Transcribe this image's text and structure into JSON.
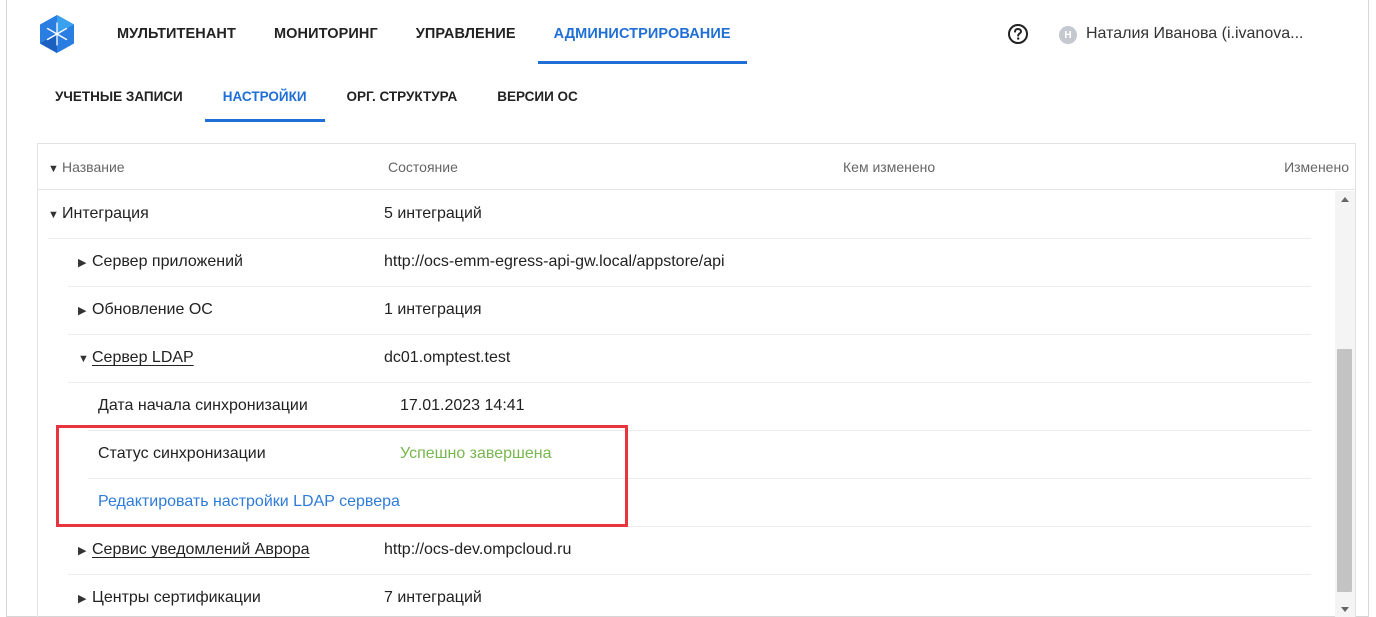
{
  "topnav": {
    "tabs": [
      {
        "label": "МУЛЬТИТЕНАНТ",
        "active": false
      },
      {
        "label": "МОНИТОРИНГ",
        "active": false
      },
      {
        "label": "УПРАВЛЕНИЕ",
        "active": false
      },
      {
        "label": "АДМИНИСТРИРОВАНИЕ",
        "active": true
      }
    ],
    "help_icon": "question-circle-icon",
    "avatar_letter": "Н",
    "user_name": "Наталия Иванова (i.ivanova..."
  },
  "subnav": {
    "tabs": [
      {
        "label": "УЧЕТНЫЕ ЗАПИСИ",
        "active": false
      },
      {
        "label": "НАСТРОЙКИ",
        "active": true
      },
      {
        "label": "ОРГ. СТРУКТУРА",
        "active": false
      },
      {
        "label": "ВЕРСИИ ОС",
        "active": false
      }
    ]
  },
  "table": {
    "headers": {
      "name": "Название",
      "state": "Состояние",
      "changed_by": "Кем изменено",
      "changed": "Изменено"
    },
    "rows": [
      {
        "name": "Интеграция",
        "value": "5 интеграций",
        "caret": "▼"
      },
      {
        "name": "Сервер приложений",
        "value": "http://ocs-emm-egress-api-gw.local/appstore/api",
        "caret": "▶"
      },
      {
        "name": "Обновление ОС",
        "value": "1 интеграция",
        "caret": "▶"
      },
      {
        "name": "Сервер LDAP",
        "value": "dc01.omptest.test",
        "caret": "▼"
      },
      {
        "name": "Дата начала синхронизации",
        "value": "17.01.2023 14:41"
      },
      {
        "name": "Статус синхронизации",
        "value": "Успешно завершена"
      },
      {
        "name": "Редактировать настройки LDAP сервера",
        "value": ""
      },
      {
        "name": "Сервис уведомлений Аврора",
        "value": "http://ocs-dev.ompcloud.ru",
        "caret": "▶"
      },
      {
        "name": "Центры сертификации",
        "value": "7 интеграций",
        "caret": "▶"
      }
    ]
  },
  "colors": {
    "accent": "#1f6fd6",
    "link": "#2f7bd8",
    "success": "#78b64f",
    "highlight": "#e8343f"
  }
}
